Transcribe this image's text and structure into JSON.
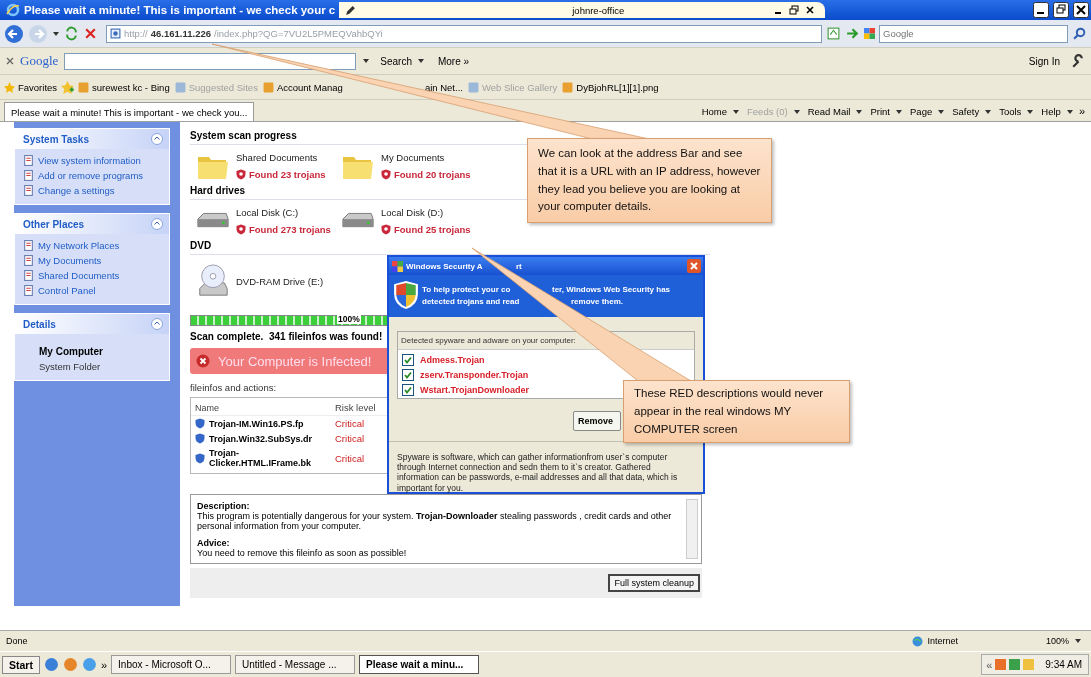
{
  "browser": {
    "title": "Please wait a minute! This is important - we check your c",
    "back_window": {
      "title": "johnre-office"
    },
    "address": {
      "scheme": "http://",
      "host": "46.161.11.226",
      "path": "/index.php?QG=7VU2L5PMEQVahbQYi"
    },
    "search_placeholder": "Google"
  },
  "google_toolbar": {
    "logo": "Google",
    "search": "Search",
    "more": "More »",
    "sign_in": "Sign In"
  },
  "favorites": {
    "label": "Favorites",
    "items": [
      {
        "label": "surewest kc - Bing",
        "disabled": false
      },
      {
        "label": "Suggested Sites",
        "disabled": true
      },
      {
        "label": "Account Manag",
        "label_tail": "ain Net...",
        "disabled": false
      },
      {
        "label": "Web Slice Gallery",
        "disabled": true
      },
      {
        "label": "DyBjohRL[1][1].png",
        "disabled": false
      }
    ]
  },
  "tab": {
    "label": "Please wait a minute! This is important - we check you...",
    "selected": true
  },
  "command_bar": {
    "items": [
      {
        "label": "Home",
        "disabled": false
      },
      {
        "label": "Feeds (0)",
        "disabled": true
      },
      {
        "label": "Read Mail",
        "disabled": false
      },
      {
        "label": "Print",
        "disabled": false
      },
      {
        "label": "Page",
        "disabled": false
      },
      {
        "label": "Safety",
        "disabled": false
      },
      {
        "label": "Tools",
        "disabled": false
      },
      {
        "label": "Help",
        "disabled": false
      }
    ],
    "overflow": "»"
  },
  "task_pane": [
    {
      "title": "System Tasks",
      "links": [
        "View system information",
        "Add or remove programs",
        "Change a settings"
      ]
    },
    {
      "title": "Other Places",
      "links": [
        "My Network Places",
        "My Documents",
        "Shared Documents",
        "Control Panel"
      ]
    },
    {
      "title": "Details",
      "name": "My Computer",
      "subtitle": "System Folder"
    }
  ],
  "scan": {
    "sections": [
      {
        "heading": "System scan progress",
        "items": [
          {
            "kind": "folder",
            "name": "Shared Documents",
            "result": "Found 23 trojans"
          },
          {
            "kind": "folder",
            "name": "My Documents",
            "result": "Found 20 trojans"
          }
        ]
      },
      {
        "heading": "Hard drives",
        "items": [
          {
            "kind": "disk",
            "name": "Local Disk (C:)",
            "result": "Found 273 trojans"
          },
          {
            "kind": "disk",
            "name": "Local Disk (D:)",
            "result": "Found 25 trojans"
          }
        ]
      },
      {
        "heading": "DVD",
        "items": [
          {
            "kind": "dvd",
            "name": "DVD-RAM Drive (E:)"
          }
        ]
      }
    ],
    "progress": {
      "level": 1,
      "label": "100%"
    },
    "result": "Scan complete.  341 fileinfos was found!",
    "alert_banner": "Your Computer is Infected!"
  },
  "fileinfos": {
    "caption": "fileinfos and actions:",
    "columns": [
      "Name",
      "Risk level"
    ],
    "rows": [
      {
        "name": "Trojan-IM.Win16.PS.fp",
        "risk": "Critical"
      },
      {
        "name": "Trojan.Win32.SubSys.dr",
        "risk": "Critical"
      },
      {
        "name": "Trojan-Clicker.HTML.IFrame.bk",
        "risk": "Critical"
      }
    ]
  },
  "description": {
    "heading": "Description:",
    "text": "This program is potentially dangerous for your system. **Trojan-Downloader** stealing passwords , credit cards and other personal information from your computer.",
    "advice_heading": "Advice:",
    "advice": "You need to remove this fileinfo as soon as possible!"
  },
  "cleanup_button": "Full system cleanup",
  "popup": {
    "title": "Windows Security A",
    "title_tail": "rt",
    "message": [
      {
        "text": "To help protect your co",
        "tail": "ter, Windows Web Security has"
      },
      {
        "text": "detected trojans and read",
        "tail": "remove them."
      }
    ],
    "list_header": "Detected spyware and adware on your computer:",
    "items": [
      {
        "name": "Admess.Trojan",
        "checked": true
      },
      {
        "name": "zserv.Transponder.Trojan",
        "checked": true
      },
      {
        "name": "Wstart.TrojanDownloader",
        "checked": true
      }
    ],
    "remove_button": "Remove",
    "footer": "Spyware is software, which can gather informationfrom user`s computer through Internet connection and sedn them to it`s creator. Gathered information can be passwords, e-mail addresses and all that data, which is important for you."
  },
  "callouts": [
    {
      "text": "We can look at the address Bar and see that it is a URL with an IP address, however they lead you believe you are looking at your computer details."
    },
    {
      "text": "These RED descriptions would never appear in the real windows MY COMPUTER screen"
    }
  ],
  "status_bar": {
    "text": "Done",
    "zone": "Internet",
    "zoom": "100%"
  },
  "taskbar": {
    "start": "Start",
    "chevron": "»",
    "buttons": [
      {
        "label": "Inbox - Microsoft O...",
        "selected": false
      },
      {
        "label": "Untitled - Message ...",
        "selected": false
      },
      {
        "label": "Please wait a minu...",
        "selected": true
      }
    ],
    "tray_chevron": "«",
    "clock": "9:34 AM"
  }
}
